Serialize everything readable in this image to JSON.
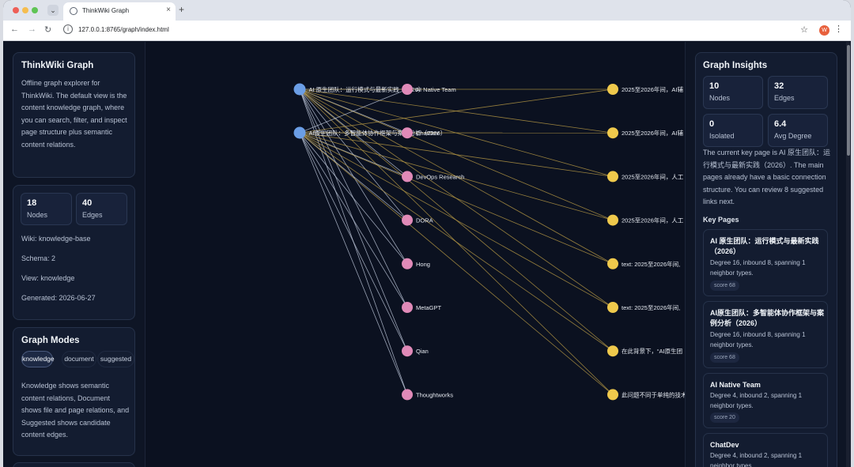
{
  "browser": {
    "tab_title": "ThinkWiki Graph",
    "url": "127.0.0.1:8765/graph/index.html",
    "new_tab": "+",
    "profile_initial": "W"
  },
  "left": {
    "title": "ThinkWiki Graph",
    "description": "Offline graph explorer for ThinkWiki. The default view is the content knowledge graph, where you can search, filter, and inspect page structure plus semantic content relations.",
    "stats": [
      {
        "value": "18",
        "label": "Nodes"
      },
      {
        "value": "40",
        "label": "Edges"
      }
    ],
    "wiki": "Wiki: knowledge-base",
    "schema": "Schema: 2",
    "view": "View: knowledge",
    "generated": "Generated: 2026-06-27",
    "modes_title": "Graph Modes",
    "modes": [
      "knowledge",
      "document",
      "suggested"
    ],
    "modes_description": "Knowledge shows semantic content relations, Document shows file and page relations, and Suggested shows candidate content edges."
  },
  "graph": {
    "sources": [
      {
        "label": "AI 原生团队：运行模式与最新实践（2026）"
      },
      {
        "label": "AI原生团队：多智能体协作框架与案例分析（2026）"
      }
    ],
    "entities": [
      {
        "label": "AI Native Team"
      },
      {
        "label": "ChatDev"
      },
      {
        "label": "DevOps Research"
      },
      {
        "label": "DORA"
      },
      {
        "label": "Hong"
      },
      {
        "label": "MetaGPT"
      },
      {
        "label": "Qian"
      },
      {
        "label": "Thoughtworks"
      }
    ],
    "claims": [
      {
        "label": "2025至2026年间，AI辅"
      },
      {
        "label": "2025至2026年间，AI辅"
      },
      {
        "label": "2025至2026年间，人工"
      },
      {
        "label": "2025至2026年间，人工"
      },
      {
        "label": "text: 2025至2026年间,"
      },
      {
        "label": "text: 2025至2026年间,"
      },
      {
        "label": "在此背景下，“AI原生团"
      },
      {
        "label": "此问题不同于单纯的技术"
      }
    ],
    "colors": {
      "source": "#6b9ee6",
      "entity": "#e08ab8",
      "claim": "#efc94c",
      "edge_white": "#c9d3e6",
      "edge_gold": "#b89a45"
    }
  },
  "right": {
    "title": "Graph Insights",
    "stats": [
      {
        "value": "10",
        "label": "Nodes"
      },
      {
        "value": "32",
        "label": "Edges"
      },
      {
        "value": "0",
        "label": "Isolated"
      },
      {
        "value": "6.4",
        "label": "Avg Degree"
      }
    ],
    "summary": "The current key page is AI 原生团队：运行模式与最新实践（2026）. The main pages already have a basic connection structure. You can review 8 suggested links next.",
    "key_pages_title": "Key Pages",
    "key_pages": [
      {
        "title": "AI 原生团队：运行模式与最新实践（2026）",
        "desc": "Degree 16, inbound 8, spanning 1 neighbor types.",
        "score": "score 68"
      },
      {
        "title": "AI原生团队：多智能体协作框架与案例分析（2026）",
        "desc": "Degree 16, inbound 8, spanning 1 neighbor types.",
        "score": "score 68"
      },
      {
        "title": "AI Native Team",
        "desc": "Degree 4, inbound 2, spanning 1 neighbor types.",
        "score": "score 20"
      },
      {
        "title": "ChatDev",
        "desc": "Degree 4, inbound 2, spanning 1 neighbor types.",
        "score": ""
      }
    ]
  }
}
